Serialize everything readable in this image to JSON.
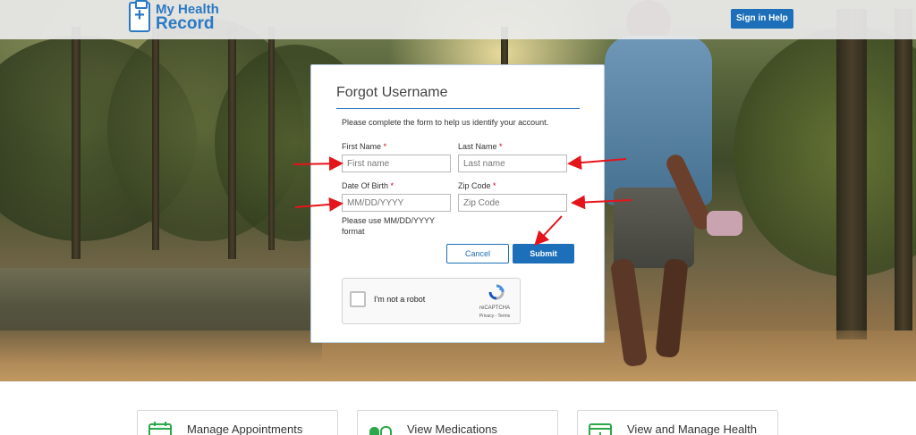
{
  "header": {
    "logo_line1": "My Health",
    "logo_line2": "Record",
    "signin_help": "Sign in Help"
  },
  "form": {
    "title": "Forgot Username",
    "intro": "Please complete the form to help us identify your account.",
    "first_name": {
      "label": "First Name",
      "required": "*",
      "placeholder": "First name",
      "value": ""
    },
    "last_name": {
      "label": "Last Name",
      "required": "*",
      "placeholder": "Last name",
      "value": ""
    },
    "dob": {
      "label": "Date Of Birth",
      "required": "*",
      "placeholder": "MM/DD/YYYY",
      "value": "",
      "help": "Please use MM/DD/YYYY format"
    },
    "zip": {
      "label": "Zip Code",
      "required": "*",
      "placeholder": "Zip Code",
      "value": ""
    },
    "cancel_label": "Cancel",
    "submit_label": "Submit",
    "captcha": {
      "label": "I'm not a robot",
      "brand": "reCAPTCHA",
      "links": "Privacy - Terms",
      "checked": false
    }
  },
  "tiles": [
    {
      "label": "Manage Appointments",
      "icon": "calendar-icon"
    },
    {
      "label": "View Medications",
      "icon": "pills-icon"
    },
    {
      "label": "View and Manage Health",
      "icon": "health-record-icon"
    }
  ],
  "colors": {
    "brand_blue": "#1c6fb8",
    "logo_blue": "#2b78c4",
    "required_red": "#d0021b",
    "annotation_red": "#e5141b",
    "tile_green": "#2aa84a"
  }
}
